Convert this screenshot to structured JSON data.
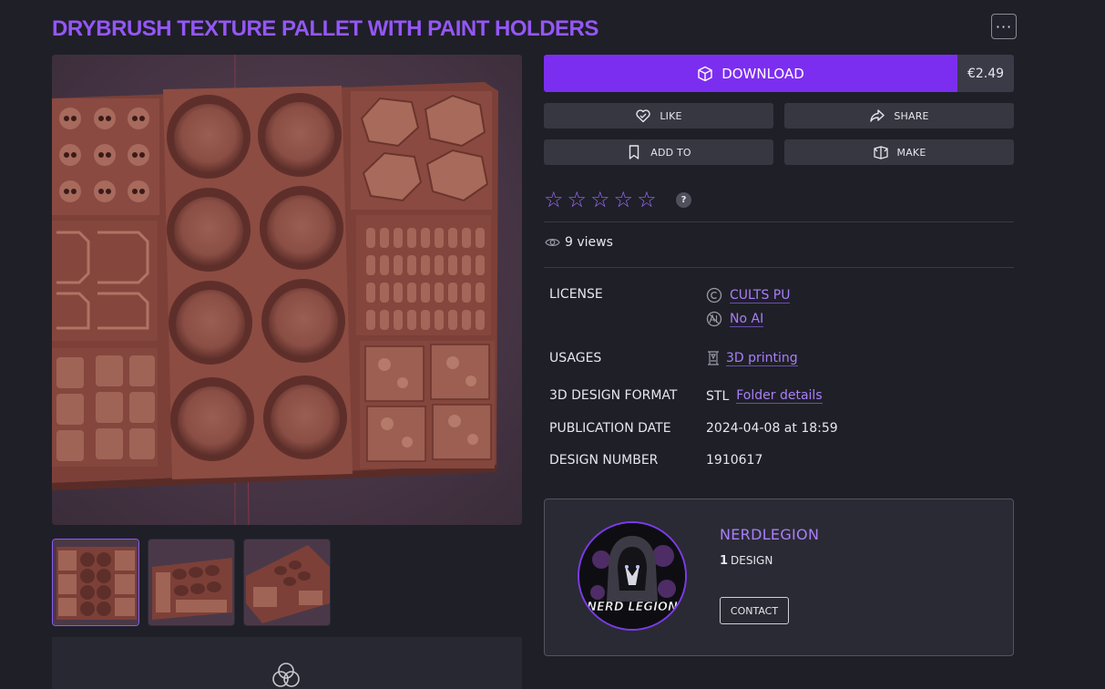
{
  "title": "DRYBRUSH TEXTURE PALLET WITH PAINT HOLDERS",
  "actions": {
    "download_label": "DOWNLOAD",
    "price": "€2.49",
    "like_label": "LIKE",
    "share_label": "SHARE",
    "add_to_label": "ADD TO",
    "make_label": "MAKE"
  },
  "rating": {
    "stars_total": 5,
    "stars_filled": 0,
    "help_label": "?"
  },
  "views": {
    "text": "9 views"
  },
  "details": {
    "license_label": "LICENSE",
    "license_values": [
      "CULTS PU",
      "No AI"
    ],
    "usages_label": "USAGES",
    "usages_value": "3D printing",
    "format_label": "3D DESIGN FORMAT",
    "format_value": "STL",
    "format_link": "Folder details",
    "pubdate_label": "PUBLICATION DATE",
    "pubdate_value": "2024-04-08 at 18:59",
    "number_label": "DESIGN NUMBER",
    "number_value": "1910617"
  },
  "author": {
    "name": "NERDLEGION",
    "design_count": "1",
    "design_label": "DESIGN",
    "contact_label": "CONTACT",
    "avatar_text": "NERD LEGION"
  },
  "gallery": {
    "thumb_count": 3,
    "active_thumb": 1
  },
  "colors": {
    "accent": "#7c2ef0",
    "link": "#a97ff9",
    "background": "#1f1f28"
  }
}
